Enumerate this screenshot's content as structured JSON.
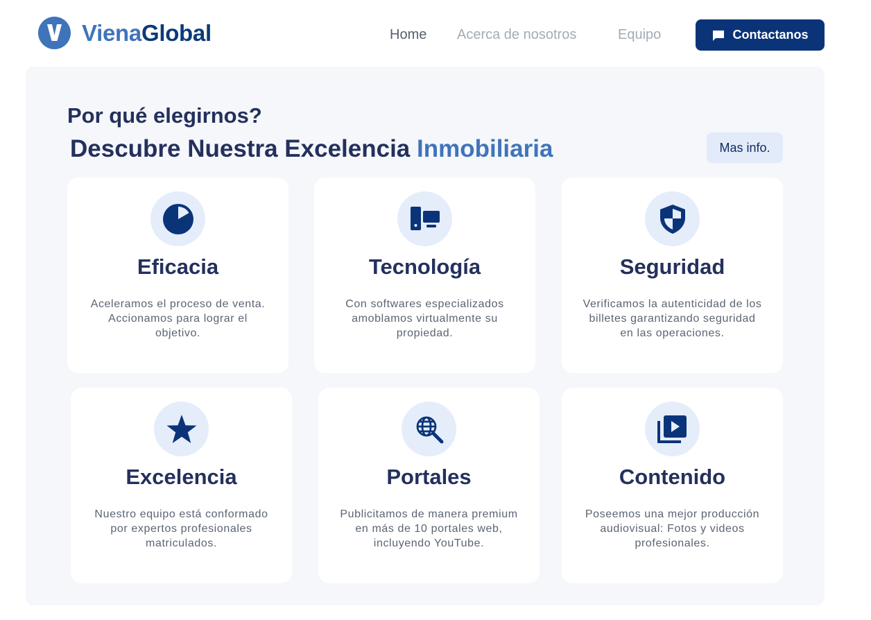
{
  "brand": {
    "name_part1": "Viena",
    "name_part2": "Global"
  },
  "nav": {
    "items": [
      {
        "label": "Home",
        "active": true
      },
      {
        "label": "Acerca de nosotros",
        "active": false
      },
      {
        "label": "Equipo",
        "active": false
      }
    ],
    "contact_label": "Contactanos"
  },
  "section": {
    "eyebrow": "Por qué elegirnos?",
    "headline_main": "Descubre Nuestra Excelencia",
    "headline_accent": "Inmobiliaria",
    "more_label": "Mas info."
  },
  "cards": [
    {
      "icon": "pie-chart-icon",
      "title": "Eficacia",
      "text": "Aceleramos el proceso de venta. Accionamos para lograr el objetivo."
    },
    {
      "icon": "devices-icon",
      "title": "Tecnología",
      "text": "Con softwares especializados amoblamos virtualmente su propiedad."
    },
    {
      "icon": "shield-icon",
      "title": "Seguridad",
      "text": "Verificamos la autenticidad de los billetes garantizando seguridad en las operaciones."
    },
    {
      "icon": "star-icon",
      "title": "Excelencia",
      "text": "Nuestro equipo está conformado por expertos profesionales matriculados."
    },
    {
      "icon": "globe-search-icon",
      "title": "Portales",
      "text": "Publicitamos de manera premium en más de 10 portales web, incluyendo YouTube."
    },
    {
      "icon": "video-library-icon",
      "title": "Contenido",
      "text": "Poseemos una mejor producción audiovisual: Fotos y videos profesionales."
    }
  ],
  "colors": {
    "primary": "#0b3478",
    "accent": "#3f74bb",
    "heading": "#24305c",
    "panel_bg": "#f5f7fa",
    "icon_bg": "#e5edfb"
  }
}
